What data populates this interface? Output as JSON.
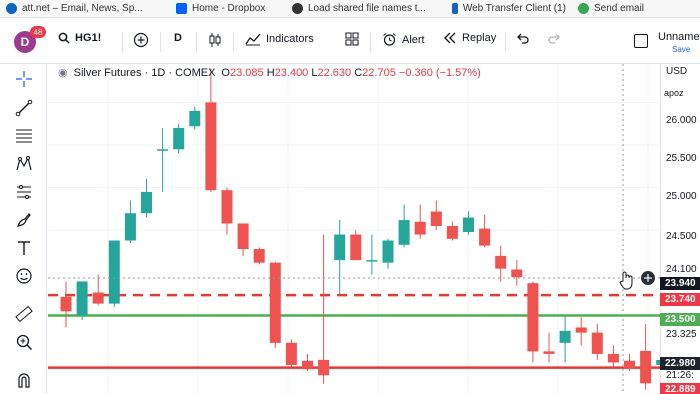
{
  "bookmarks": [
    {
      "label": "att.net – Email, News, Sp...",
      "icon": "globe-icon",
      "color": "#0a66c2"
    },
    {
      "label": "Home - Dropbox",
      "icon": "dropbox-icon",
      "color": "#0061fe"
    },
    {
      "label": "Load shared file names t...",
      "icon": "github-icon",
      "color": "#333333"
    },
    {
      "label": "Web Transfer Client (1)",
      "icon": "transfer-icon",
      "color": "#1565c0"
    },
    {
      "label": "Send email",
      "icon": "send-icon",
      "color": "#34a853"
    }
  ],
  "toolbar": {
    "avatar_letter": "D",
    "avatar_badge": "48",
    "symbol": "HG1!",
    "interval": "D",
    "indicators": "Indicators",
    "alert": "Alert",
    "replay": "Replay",
    "layout_name": "Unname",
    "save": "Save"
  },
  "legend": {
    "title": "Silver Futures · 1D · COMEX",
    "o_label": "O",
    "o": "23.085",
    "h_label": "H",
    "h": "23.400",
    "l_label": "L",
    "l": "22.630",
    "c_label": "C",
    "c": "22.705",
    "change": "−0.360 (−1.57%)"
  },
  "axis": {
    "currency": "USD",
    "mode": "apoz",
    "ticks": [
      "26.000",
      "25.500",
      "25.000",
      "24.500",
      "24.100",
      "23.325",
      "21:26:"
    ],
    "labels": [
      {
        "text": "23.940",
        "color": "#131722"
      },
      {
        "text": "23.740",
        "color": "#f23645"
      },
      {
        "text": "23.500",
        "color": "#4caf50"
      },
      {
        "text": "22.980",
        "color": "#1e222d"
      },
      {
        "text": "22.889",
        "color": "#f23645"
      }
    ]
  },
  "colors": {
    "up": "#26a69a",
    "down": "#ef5350",
    "support": "#4caf50",
    "resistance": "#e53935"
  },
  "chart_data": {
    "type": "candlestick",
    "title": "Silver Futures · 1D · COMEX",
    "ylim": [
      22.58,
      26.45
    ],
    "y_ticks": [
      26.0,
      25.5,
      25.0,
      24.5
    ],
    "lines": [
      {
        "price": 23.74,
        "style": "dashed",
        "color": "#e53935"
      },
      {
        "price": 23.5,
        "style": "solid",
        "color": "#4caf50"
      },
      {
        "price": 22.889,
        "style": "solid",
        "color": "#e53935"
      }
    ],
    "candles": [
      {
        "o": 23.72,
        "h": 23.9,
        "l": 23.36,
        "c": 23.55
      },
      {
        "o": 23.5,
        "h": 23.9,
        "l": 23.45,
        "c": 23.9
      },
      {
        "o": 23.77,
        "h": 23.98,
        "l": 23.62,
        "c": 23.64
      },
      {
        "o": 23.64,
        "h": 24.38,
        "l": 23.6,
        "c": 24.38
      },
      {
        "o": 24.38,
        "h": 24.85,
        "l": 24.35,
        "c": 24.7
      },
      {
        "o": 24.7,
        "h": 25.1,
        "l": 24.65,
        "c": 24.95
      },
      {
        "o": 25.45,
        "h": 25.7,
        "l": 24.95,
        "c": 25.45
      },
      {
        "o": 25.45,
        "h": 25.75,
        "l": 25.4,
        "c": 25.7
      },
      {
        "o": 25.72,
        "h": 25.95,
        "l": 25.68,
        "c": 25.9
      },
      {
        "o": 26.0,
        "h": 26.4,
        "l": 24.95,
        "c": 24.97
      },
      {
        "o": 24.97,
        "h": 25.0,
        "l": 24.45,
        "c": 24.58
      },
      {
        "o": 24.58,
        "h": 24.58,
        "l": 24.2,
        "c": 24.28
      },
      {
        "o": 24.28,
        "h": 24.3,
        "l": 24.1,
        "c": 24.12
      },
      {
        "o": 24.12,
        "h": 24.13,
        "l": 23.12,
        "c": 23.18
      },
      {
        "o": 23.18,
        "h": 23.22,
        "l": 22.9,
        "c": 22.92
      },
      {
        "o": 22.97,
        "h": 23.05,
        "l": 22.85,
        "c": 22.87
      },
      {
        "o": 22.98,
        "h": 24.45,
        "l": 22.7,
        "c": 22.8
      },
      {
        "o": 24.15,
        "h": 24.62,
        "l": 23.75,
        "c": 24.45
      },
      {
        "o": 24.45,
        "h": 24.5,
        "l": 24.15,
        "c": 24.15
      },
      {
        "o": 24.15,
        "h": 24.45,
        "l": 23.98,
        "c": 24.15
      },
      {
        "o": 24.12,
        "h": 24.4,
        "l": 24.05,
        "c": 24.38
      },
      {
        "o": 24.33,
        "h": 24.8,
        "l": 24.3,
        "c": 24.62
      },
      {
        "o": 24.6,
        "h": 24.8,
        "l": 24.4,
        "c": 24.45
      },
      {
        "o": 24.72,
        "h": 24.85,
        "l": 24.5,
        "c": 24.55
      },
      {
        "o": 24.55,
        "h": 24.6,
        "l": 24.38,
        "c": 24.4
      },
      {
        "o": 24.48,
        "h": 24.72,
        "l": 24.45,
        "c": 24.65
      },
      {
        "o": 24.52,
        "h": 24.68,
        "l": 24.3,
        "c": 24.32
      },
      {
        "o": 24.2,
        "h": 24.32,
        "l": 23.9,
        "c": 24.05
      },
      {
        "o": 24.04,
        "h": 24.15,
        "l": 23.85,
        "c": 23.95
      },
      {
        "o": 23.88,
        "h": 23.9,
        "l": 22.95,
        "c": 23.08
      },
      {
        "o": 23.08,
        "h": 23.3,
        "l": 22.95,
        "c": 23.05
      },
      {
        "o": 23.18,
        "h": 23.5,
        "l": 22.95,
        "c": 23.32
      },
      {
        "o": 23.36,
        "h": 23.48,
        "l": 23.15,
        "c": 23.3
      },
      {
        "o": 23.3,
        "h": 23.4,
        "l": 22.98,
        "c": 23.05
      },
      {
        "o": 23.05,
        "h": 23.15,
        "l": 22.9,
        "c": 22.95
      },
      {
        "o": 22.97,
        "h": 23.05,
        "l": 22.85,
        "c": 22.88
      },
      {
        "o": 23.085,
        "h": 23.4,
        "l": 22.63,
        "c": 22.705
      },
      {
        "o": 22.92,
        "h": 23.0,
        "l": 22.9,
        "c": 22.98
      }
    ]
  }
}
